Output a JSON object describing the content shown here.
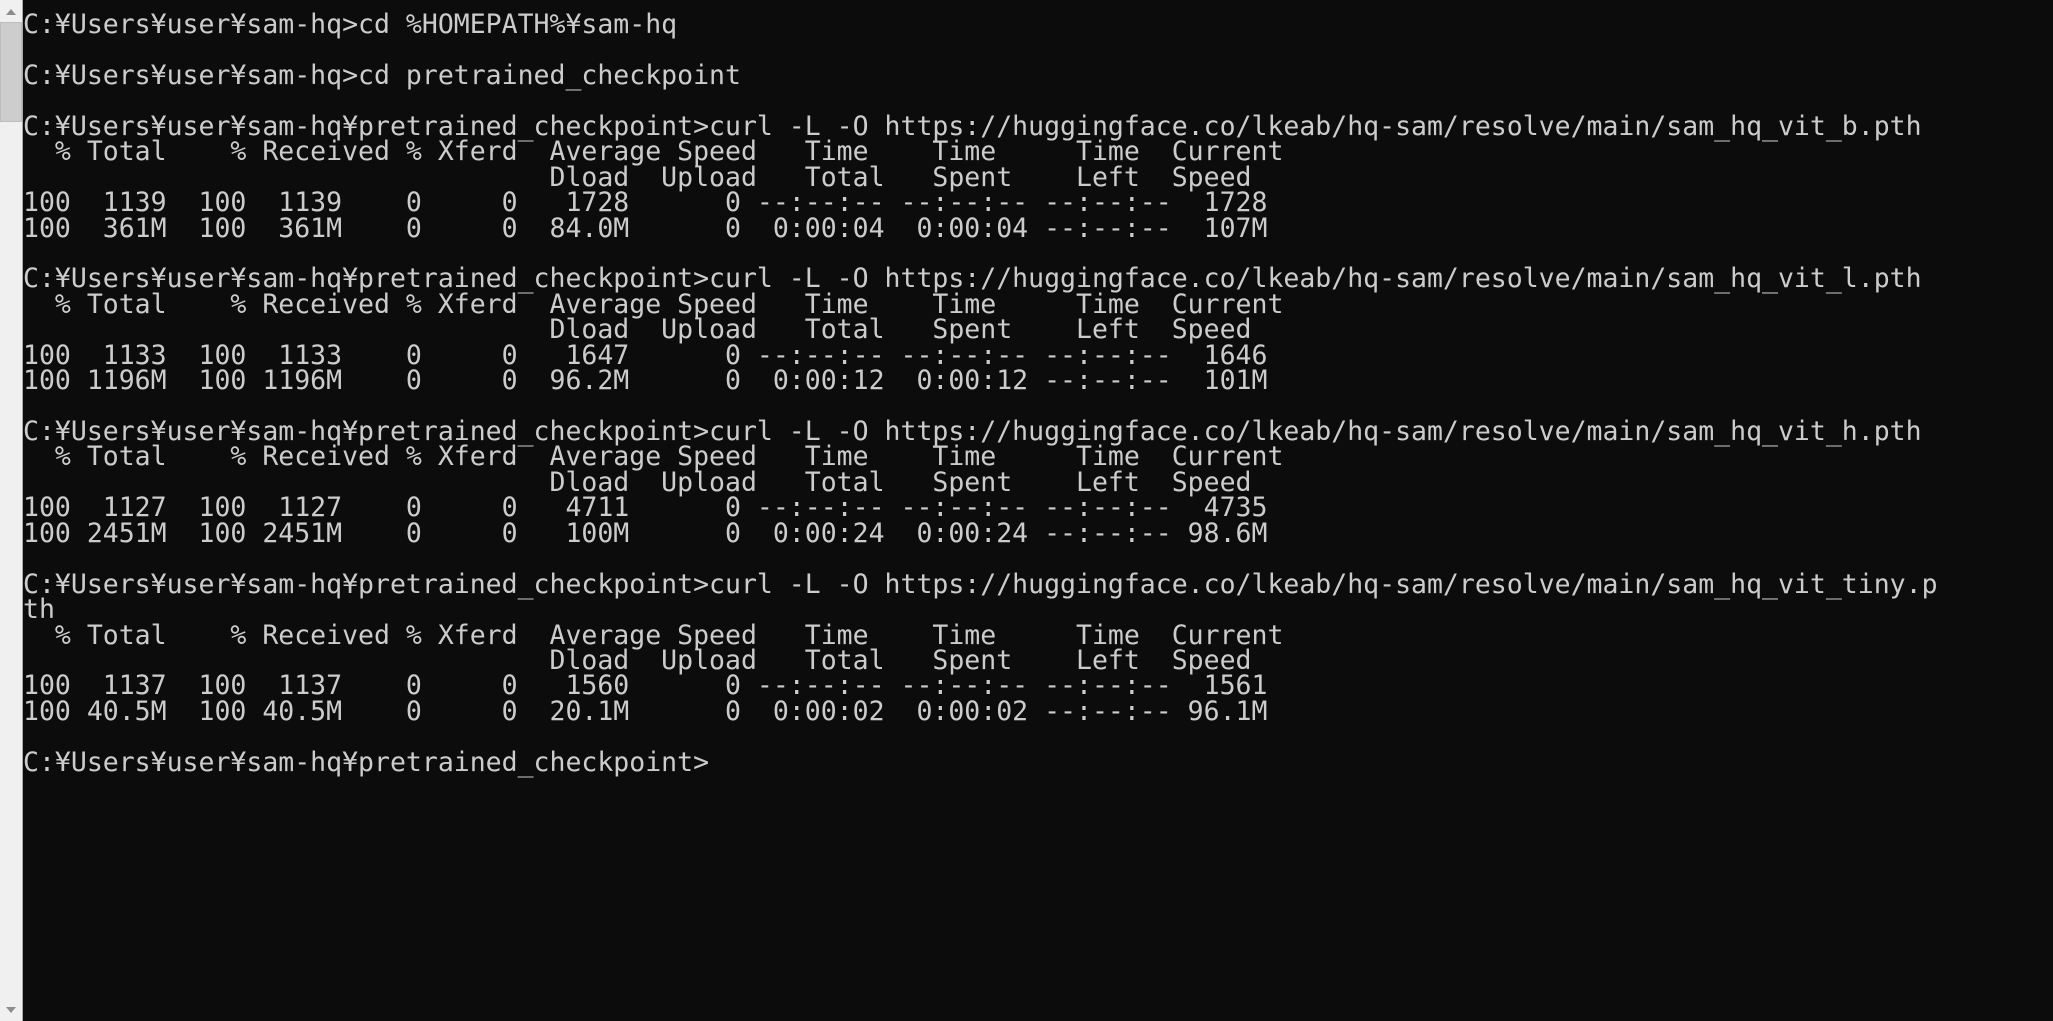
{
  "window": {
    "app": "Command Prompt",
    "shell": "cmd.exe",
    "locale_note": "Japanese locale renders backslash as yen sign",
    "background_color": "#0c0c0c",
    "foreground_color": "#cccccc",
    "scrollbar_color": "#f0f0f0",
    "thumb_color": "#cdcdcd"
  },
  "scrollbar": {
    "up_arrow": "scroll-up-arrow",
    "down_arrow": "scroll-down-arrow",
    "thumb": "scroll-thumb"
  },
  "terminal": {
    "prompt_base": "C:¥Users¥user¥sam-hq",
    "prompt_checkpoint": "C:¥Users¥user¥sam-hq¥pretrained_checkpoint",
    "lines": [
      "C:¥Users¥user¥sam-hq>",
      "C:¥Users¥user¥sam-hq>cd %HOMEPATH%¥sam-hq",
      "",
      "C:¥Users¥user¥sam-hq>cd pretrained_checkpoint",
      "",
      "C:¥Users¥user¥sam-hq¥pretrained_checkpoint>curl -L -O https://huggingface.co/lkeab/hq-sam/resolve/main/sam_hq_vit_b.pth",
      "  % Total    % Received % Xferd  Average Speed   Time    Time     Time  Current",
      "                                 Dload  Upload   Total   Spent    Left  Speed",
      "100  1139  100  1139    0     0   1728      0 --:--:-- --:--:-- --:--:--  1728",
      "100  361M  100  361M    0     0  84.0M      0  0:00:04  0:00:04 --:--:--  107M",
      "",
      "C:¥Users¥user¥sam-hq¥pretrained_checkpoint>curl -L -O https://huggingface.co/lkeab/hq-sam/resolve/main/sam_hq_vit_l.pth",
      "  % Total    % Received % Xferd  Average Speed   Time    Time     Time  Current",
      "                                 Dload  Upload   Total   Spent    Left  Speed",
      "100  1133  100  1133    0     0   1647      0 --:--:-- --:--:-- --:--:--  1646",
      "100 1196M  100 1196M    0     0  96.2M      0  0:00:12  0:00:12 --:--:--  101M",
      "",
      "C:¥Users¥user¥sam-hq¥pretrained_checkpoint>curl -L -O https://huggingface.co/lkeab/hq-sam/resolve/main/sam_hq_vit_h.pth",
      "  % Total    % Received % Xferd  Average Speed   Time    Time     Time  Current",
      "                                 Dload  Upload   Total   Spent    Left  Speed",
      "100  1127  100  1127    0     0   4711      0 --:--:-- --:--:-- --:--:--  4735",
      "100 2451M  100 2451M    0     0   100M      0  0:00:24  0:00:24 --:--:-- 98.6M",
      "",
      "C:¥Users¥user¥sam-hq¥pretrained_checkpoint>curl -L -O https://huggingface.co/lkeab/hq-sam/resolve/main/sam_hq_vit_tiny.p",
      "th",
      "  % Total    % Received % Xferd  Average Speed   Time    Time     Time  Current",
      "                                 Dload  Upload   Total   Spent    Left  Speed",
      "100  1137  100  1137    0     0   1560      0 --:--:-- --:--:-- --:--:--  1561",
      "100 40.5M  100 40.5M    0     0  20.1M      0  0:00:02  0:00:02 --:--:-- 96.1M",
      "",
      "C:¥Users¥user¥sam-hq¥pretrained_checkpoint>"
    ],
    "transfers": [
      {
        "command": "curl -L -O https://huggingface.co/lkeab/hq-sam/resolve/main/sam_hq_vit_b.pth",
        "file": "sam_hq_vit_b.pth",
        "headers_row1": [
          "% Total",
          "% Received",
          "% Xferd",
          "Average Speed",
          "Time",
          "Time",
          "Time",
          "Current"
        ],
        "headers_row2": [
          "Dload",
          "Upload",
          "Total",
          "Spent",
          "Left",
          "Speed"
        ],
        "rows": [
          {
            "pct_total": "100",
            "total": "1139",
            "pct_received": "100",
            "received": "1139",
            "pct_xferd": "0",
            "xferd": "0",
            "dload": "1728",
            "upload": "0",
            "time_total": "--:--:--",
            "time_spent": "--:--:--",
            "time_left": "--:--:--",
            "current_speed": "1728"
          },
          {
            "pct_total": "100",
            "total": "361M",
            "pct_received": "100",
            "received": "361M",
            "pct_xferd": "0",
            "xferd": "0",
            "dload": "84.0M",
            "upload": "0",
            "time_total": "0:00:04",
            "time_spent": "0:00:04",
            "time_left": "--:--:--",
            "current_speed": "107M"
          }
        ]
      },
      {
        "command": "curl -L -O https://huggingface.co/lkeab/hq-sam/resolve/main/sam_hq_vit_l.pth",
        "file": "sam_hq_vit_l.pth",
        "rows": [
          {
            "pct_total": "100",
            "total": "1133",
            "pct_received": "100",
            "received": "1133",
            "pct_xferd": "0",
            "xferd": "0",
            "dload": "1647",
            "upload": "0",
            "time_total": "--:--:--",
            "time_spent": "--:--:--",
            "time_left": "--:--:--",
            "current_speed": "1646"
          },
          {
            "pct_total": "100",
            "total": "1196M",
            "pct_received": "100",
            "received": "1196M",
            "pct_xferd": "0",
            "xferd": "0",
            "dload": "96.2M",
            "upload": "0",
            "time_total": "0:00:12",
            "time_spent": "0:00:12",
            "time_left": "--:--:--",
            "current_speed": "101M"
          }
        ]
      },
      {
        "command": "curl -L -O https://huggingface.co/lkeab/hq-sam/resolve/main/sam_hq_vit_h.pth",
        "file": "sam_hq_vit_h.pth",
        "rows": [
          {
            "pct_total": "100",
            "total": "1127",
            "pct_received": "100",
            "received": "1127",
            "pct_xferd": "0",
            "xferd": "0",
            "dload": "4711",
            "upload": "0",
            "time_total": "--:--:--",
            "time_spent": "--:--:--",
            "time_left": "--:--:--",
            "current_speed": "4735"
          },
          {
            "pct_total": "100",
            "total": "2451M",
            "pct_received": "100",
            "received": "2451M",
            "pct_xferd": "0",
            "xferd": "0",
            "dload": "100M",
            "upload": "0",
            "time_total": "0:00:24",
            "time_spent": "0:00:24",
            "time_left": "--:--:--",
            "current_speed": "98.6M"
          }
        ]
      },
      {
        "command": "curl -L -O https://huggingface.co/lkeab/hq-sam/resolve/main/sam_hq_vit_tiny.pth",
        "file": "sam_hq_vit_tiny.pth",
        "rows": [
          {
            "pct_total": "100",
            "total": "1137",
            "pct_received": "100",
            "received": "1137",
            "pct_xferd": "0",
            "xferd": "0",
            "dload": "1560",
            "upload": "0",
            "time_total": "--:--:--",
            "time_spent": "--:--:--",
            "time_left": "--:--:--",
            "current_speed": "1561"
          },
          {
            "pct_total": "100",
            "total": "40.5M",
            "pct_received": "100",
            "received": "40.5M",
            "pct_xferd": "0",
            "xferd": "0",
            "dload": "20.1M",
            "upload": "0",
            "time_total": "0:00:02",
            "time_spent": "0:00:02",
            "time_left": "--:--:--",
            "current_speed": "96.1M"
          }
        ]
      }
    ]
  }
}
